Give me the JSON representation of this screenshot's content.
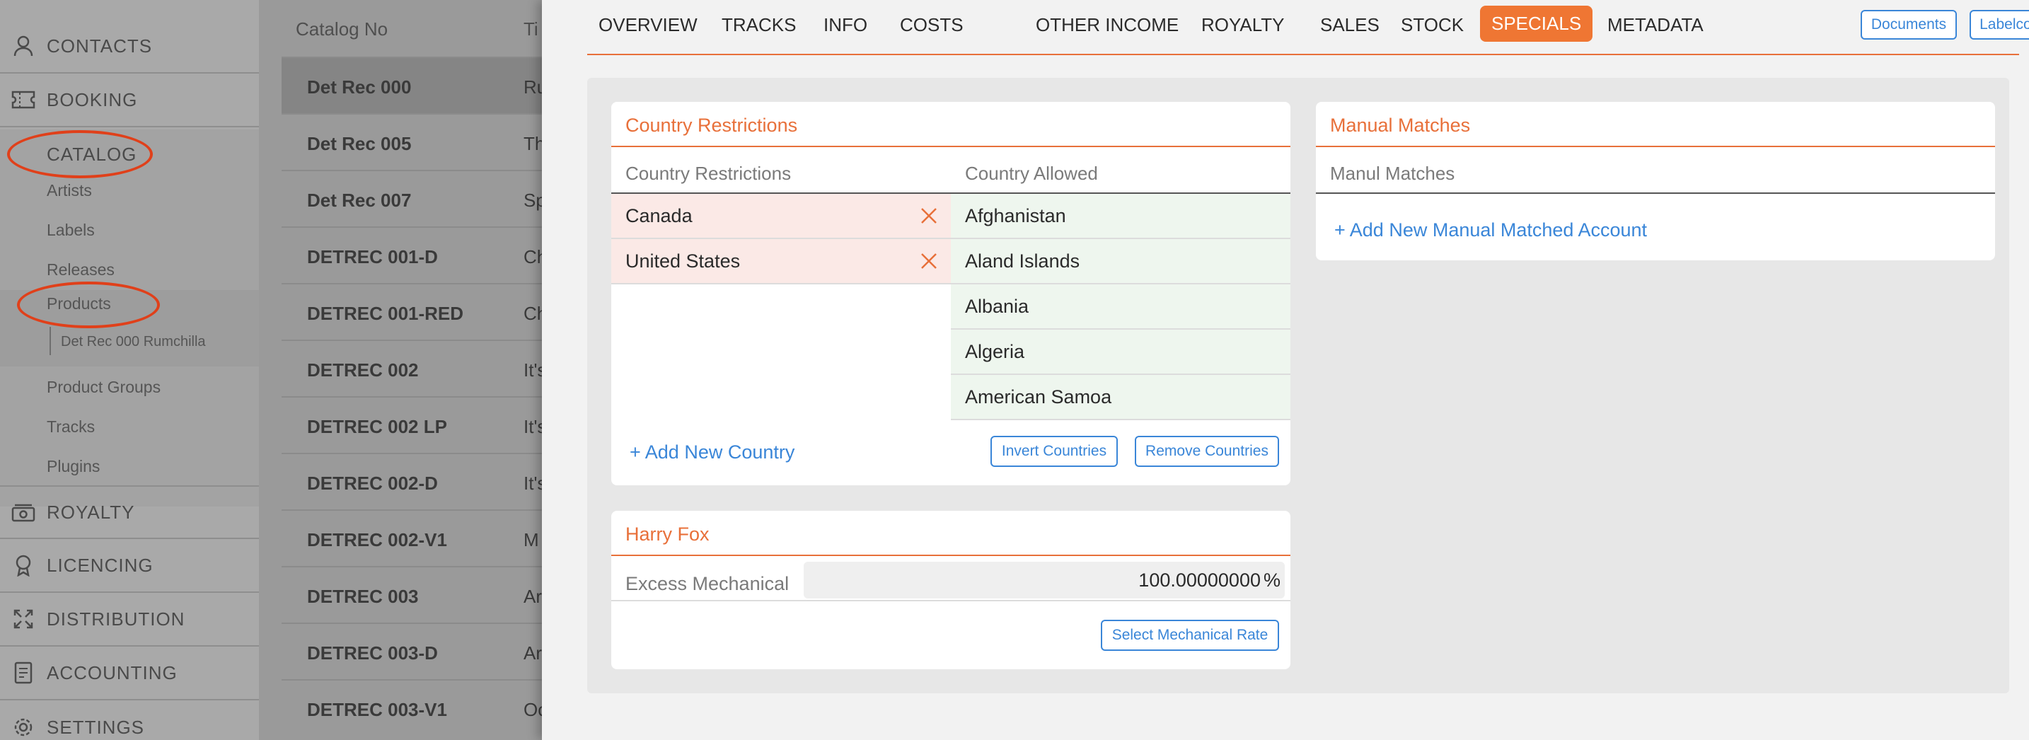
{
  "sidebar": {
    "contacts": "CONTACTS",
    "booking": "BOOKING",
    "catalog": "CATALOG",
    "artists": "Artists",
    "labels": "Labels",
    "releases": "Releases",
    "products": "Products",
    "product_item": "Det Rec 000 Rumchilla",
    "product_groups": "Product Groups",
    "tracks": "Tracks",
    "plugins": "Plugins",
    "royalty": "ROYALTY",
    "licencing": "LICENCING",
    "distribution": "DISTRIBUTION",
    "accounting": "ACCOUNTING",
    "settings": "SETTINGS"
  },
  "catalog_list": {
    "header_catalog_no": "Catalog No",
    "header_title": "Ti",
    "rows": [
      {
        "no": "Det Rec 000",
        "title": "Ru"
      },
      {
        "no": "Det Rec 005",
        "title": "Th"
      },
      {
        "no": "Det Rec 007",
        "title": "Sp"
      },
      {
        "no": "DETREC 001-D",
        "title": "Ch"
      },
      {
        "no": "DETREC 001-RED",
        "title": "Ch"
      },
      {
        "no": "DETREC 002",
        "title": "It's"
      },
      {
        "no": "DETREC 002 LP",
        "title": "It's"
      },
      {
        "no": "DETREC 002-D",
        "title": "It's"
      },
      {
        "no": "DETREC 002-V1",
        "title": "M"
      },
      {
        "no": "DETREC 003",
        "title": "Ar"
      },
      {
        "no": "DETREC 003-D",
        "title": "Ar"
      },
      {
        "no": "DETREC 003-V1",
        "title": "Oc"
      }
    ]
  },
  "tabs": [
    "OVERVIEW",
    "TRACKS",
    "INFO",
    "COSTS",
    "OTHER INCOME",
    "ROYALTY",
    "SALES",
    "STOCK",
    "SPECIALS",
    "METADATA"
  ],
  "active_tab": "SPECIALS",
  "header_buttons": {
    "documents": "Documents",
    "labelcopy": "Labelcopy"
  },
  "country_restrictions": {
    "title": "Country Restrictions",
    "col_restrictions": "Country Restrictions",
    "col_allowed": "Country Allowed",
    "restricted": [
      "Canada",
      "United States"
    ],
    "allowed": [
      "Afghanistan",
      "Aland Islands",
      "Albania",
      "Algeria",
      "American Samoa"
    ],
    "add_link": "+ Add New Country",
    "invert_button": "Invert Countries",
    "remove_button": "Remove Countries"
  },
  "harry_fox": {
    "title": "Harry Fox",
    "excess_label": "Excess Mechanical",
    "excess_value": "100.00000000",
    "excess_unit": "%",
    "select_button": "Select Mechanical Rate"
  },
  "manual_matches": {
    "title": "Manual Matches",
    "col_head": "Manul Matches",
    "add_link": "+ Add New Manual Matched Account"
  },
  "colors": {
    "accent": "#ef7633",
    "link": "#3a86d8",
    "annotation": "#e0401a"
  },
  "icons": {
    "contacts": "person-icon",
    "booking": "ticket-icon",
    "royalty": "cash-icon",
    "licencing": "award-icon",
    "distribution": "expand-icon",
    "accounting": "document-icon",
    "settings": "gear-icon",
    "remove": "close-icon"
  }
}
